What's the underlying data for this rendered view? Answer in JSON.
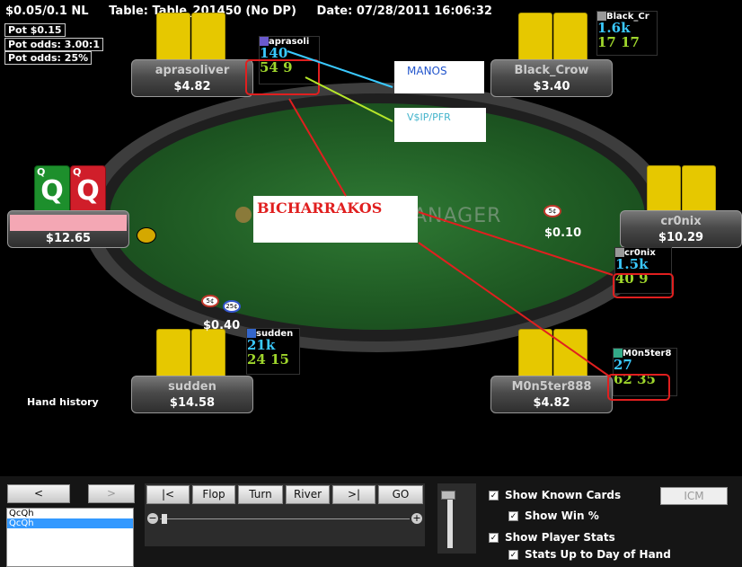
{
  "header": {
    "stakes": "$0.05/0.1 NL",
    "table": "Table: Table_201450 (No DP)",
    "date": "Date: 07/28/2011 16:06:32"
  },
  "pot_info": [
    "Pot $0.15",
    "Pot odds: 3.00:1",
    "Pot odds: 25%"
  ],
  "watermark": "ANAGER",
  "players": {
    "aprasoliver": {
      "name": "aprasoliver",
      "stack": "$4.82",
      "hud_name": "aprasoli",
      "hud_line1": "140",
      "hud_line2": "54 9"
    },
    "black_crow": {
      "name": "Black_Crow",
      "stack": "$3.40",
      "hud_name": "Black_Cr",
      "hud_line1": "1.6k",
      "hud_line2": "17 17"
    },
    "cr0nix": {
      "name": "cr0nix",
      "stack": "$10.29",
      "hud_name": "cr0nix",
      "hud_line1": "1.5k",
      "hud_line2": "40 9",
      "bet": "$0.10"
    },
    "m0n5ter888": {
      "name": "M0n5ter888",
      "stack": "$4.82",
      "hud_name": "M0n5ter8",
      "hud_line1": "27",
      "hud_line2": "62 35"
    },
    "sudden": {
      "name": "sudden",
      "stack": "$14.58",
      "hud_name": "sudden",
      "hud_line1": "21k",
      "hud_line2": "24 15",
      "bet": "$0.40"
    },
    "hero": {
      "stack": "$12.65",
      "card_rank_1": "Q",
      "card_rank_2": "Q"
    }
  },
  "chips": {
    "cr0nix": "5¢",
    "sudden_1": "5¢",
    "sudden_2": "25¢"
  },
  "annotations": {
    "manos": "MANOS",
    "vpip": "V$IP/PFR",
    "bicharrakos": "BICHARRAKOS"
  },
  "hand_history_label": "Hand history",
  "replayer": {
    "prev": "<",
    "next": ">",
    "hands": [
      "QcQh",
      "QcQh"
    ],
    "btn_start": "|<",
    "btn_flop": "Flop",
    "btn_turn": "Turn",
    "btn_river": "River",
    "btn_end": ">|",
    "btn_go": "GO"
  },
  "options": {
    "show_known_cards": "Show Known Cards",
    "show_win": "Show Win %",
    "show_player_stats": "Show Player Stats",
    "stats_up_to_day": "Stats Up to Day of Hand",
    "icm": "ICM"
  },
  "colors": {
    "annotation_red": "#e01f1f",
    "hud_blue": "#3ac9ff",
    "hud_green": "#9fd62c",
    "felt": "#1f5a23"
  }
}
